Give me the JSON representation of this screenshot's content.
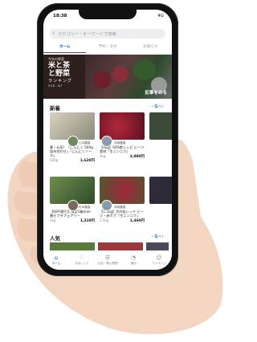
{
  "status_bar": {
    "time": "18:38",
    "signal": "4G"
  },
  "search": {
    "placeholder": "カテゴリー・キーワードで検索"
  },
  "tabs": [
    {
      "label": "ホーム",
      "active": true
    },
    {
      "label": "予約・注文"
    },
    {
      "label": "お知らせ"
    }
  ],
  "banner": {
    "tag": "今年の野菜",
    "title_line1": "米と茶",
    "title_line2": "と野菜",
    "subtitle": "ランキング",
    "date": "9/18 - 4/7",
    "cta": "記事をみる"
  },
  "new_section": {
    "title": "新着",
    "more": "一覧へ〉"
  },
  "popular_section": {
    "title": "人気",
    "more": "一覧へ〉"
  },
  "new_items": [
    {
      "shop": "山中農園",
      "title": "夏・元気！「にんにく 500g詰め合わせ」「にんにくソース」",
      "weight": "500g",
      "price": "1,620円"
    },
    {
      "shop": "寺嶋農園",
      "title": "【4kg】SOS食レシピ ビーツ食材「生ニンニク」",
      "weight": "4kg",
      "price": "3,980円"
    },
    {
      "shop": "鈴木農園",
      "title": "【60円割引】限定1箱のみ！ 春ゼブラフェアリー",
      "weight": "1kg",
      "price": "1,310円"
    },
    {
      "shop": "寺嶋農園",
      "title": "【1.5kg】大の粒レッド ビーツ・赤カブ「生ニンニク」",
      "weight": "1.5kg",
      "price": "1,460円"
    }
  ],
  "bottom_nav": [
    {
      "label": "ホーム",
      "icon": "home-icon",
      "active": true
    },
    {
      "label": "お気に入り",
      "icon": "heart-icon"
    },
    {
      "label": "出品・購入履歴",
      "icon": "list-icon"
    },
    {
      "label": "通知",
      "icon": "bell-icon"
    },
    {
      "label": "マイページ",
      "icon": "user-icon"
    }
  ]
}
